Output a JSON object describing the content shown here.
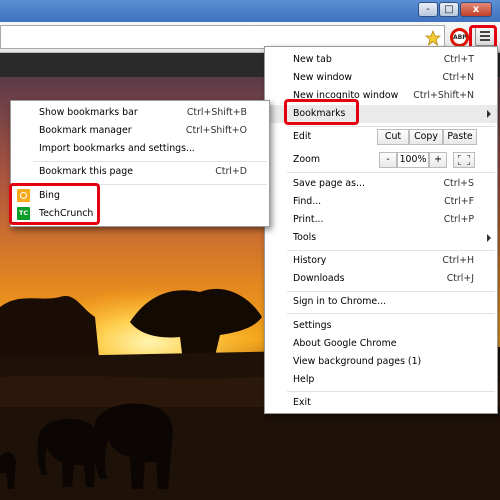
{
  "window": {
    "minimize": "-",
    "maximize": "□",
    "close": "x"
  },
  "toolbar": {
    "star_icon": "star-icon",
    "menu_icon": "hamburger-menu-icon",
    "extension": "ABP"
  },
  "chrome_menu": {
    "new_tab": {
      "label": "New tab",
      "shortcut": "Ctrl+T"
    },
    "new_window": {
      "label": "New window",
      "shortcut": "Ctrl+N"
    },
    "new_incognito": {
      "label": "New incognito window",
      "shortcut": "Ctrl+Shift+N"
    },
    "bookmarks": {
      "label": "Bookmarks"
    },
    "edit": {
      "label": "Edit",
      "cut": "Cut",
      "copy": "Copy",
      "paste": "Paste"
    },
    "zoom": {
      "label": "Zoom",
      "minus": "-",
      "level": "100%",
      "plus": "+"
    },
    "save_page": {
      "label": "Save page as...",
      "shortcut": "Ctrl+S"
    },
    "find": {
      "label": "Find...",
      "shortcut": "Ctrl+F"
    },
    "print": {
      "label": "Print...",
      "shortcut": "Ctrl+P"
    },
    "tools": {
      "label": "Tools"
    },
    "history": {
      "label": "History",
      "shortcut": "Ctrl+H"
    },
    "downloads": {
      "label": "Downloads",
      "shortcut": "Ctrl+J"
    },
    "sign_in": {
      "label": "Sign in to Chrome..."
    },
    "settings": {
      "label": "Settings"
    },
    "about": {
      "label": "About Google Chrome"
    },
    "background_pages": {
      "label": "View background pages (1)"
    },
    "help": {
      "label": "Help"
    },
    "exit": {
      "label": "Exit"
    }
  },
  "bookmarks_menu": {
    "show_bar": {
      "label": "Show bookmarks bar",
      "shortcut": "Ctrl+Shift+B"
    },
    "manager": {
      "label": "Bookmark manager",
      "shortcut": "Ctrl+Shift+O"
    },
    "import": {
      "label": "Import bookmarks and settings..."
    },
    "bookmark_page": {
      "label": "Bookmark this page",
      "shortcut": "Ctrl+D"
    },
    "sites": [
      {
        "label": "Bing",
        "icon": "bing-favicon"
      },
      {
        "label": "TechCrunch",
        "icon": "techcrunch-favicon",
        "icon_text": "TC"
      }
    ]
  }
}
